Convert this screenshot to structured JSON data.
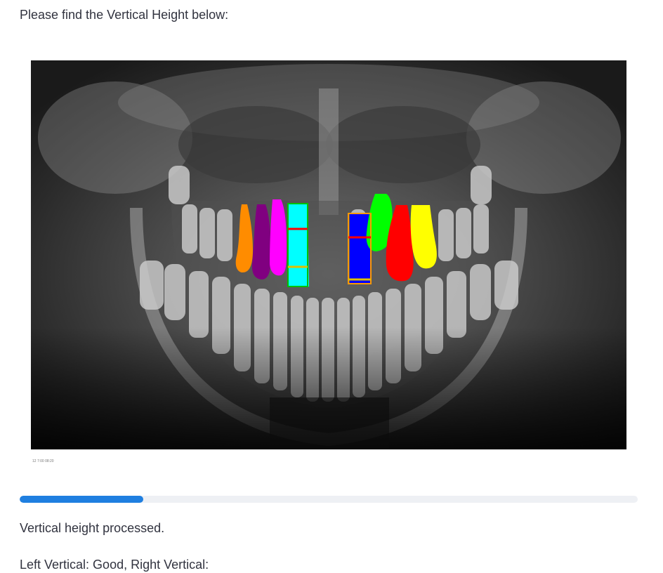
{
  "page": {
    "heading": "Please find the Vertical Height below:",
    "status_text": "Vertical height processed.",
    "result_text": "Left Vertical: Good, Right Vertical:"
  },
  "figure": {
    "image_caption": "12 7:00 08:20",
    "annotation_colors": [
      "#ff8c00",
      "#800080",
      "#ff00ff",
      "#00ffff",
      "#0000ff",
      "#00ff00",
      "#ff0000",
      "#ffff00"
    ]
  },
  "progress": {
    "value": 0.2,
    "color": "#1f7fe0"
  }
}
